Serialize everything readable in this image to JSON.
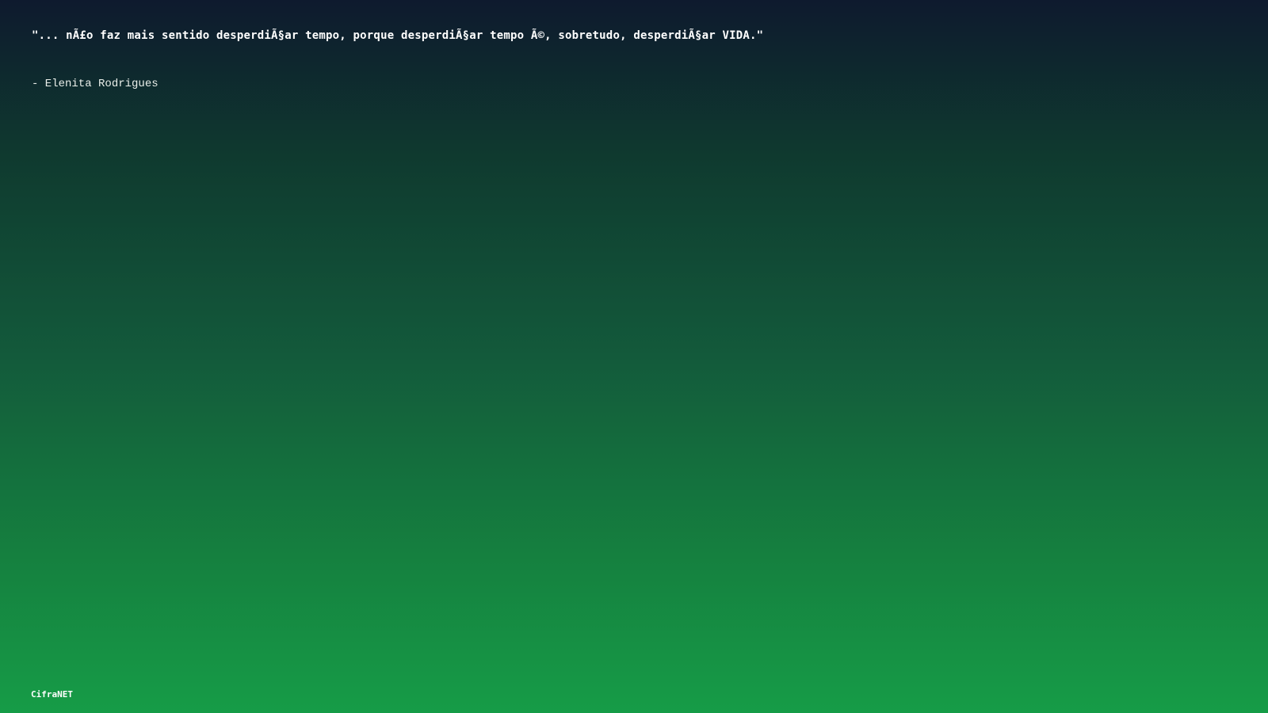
{
  "quote": {
    "text": "\"... nÃ£o faz mais sentido desperdiÃ§ar tempo, porque desperdiÃ§ar tempo Ã©, sobretudo, desperdiÃ§ar VIDA.\""
  },
  "author": {
    "text": "- Elenita Rodrigues"
  },
  "brand": {
    "text": "CifraNET"
  },
  "colors": {
    "gradient_top": "#0e1a2e",
    "gradient_bottom": "#169c47",
    "text": "#ffffff"
  }
}
